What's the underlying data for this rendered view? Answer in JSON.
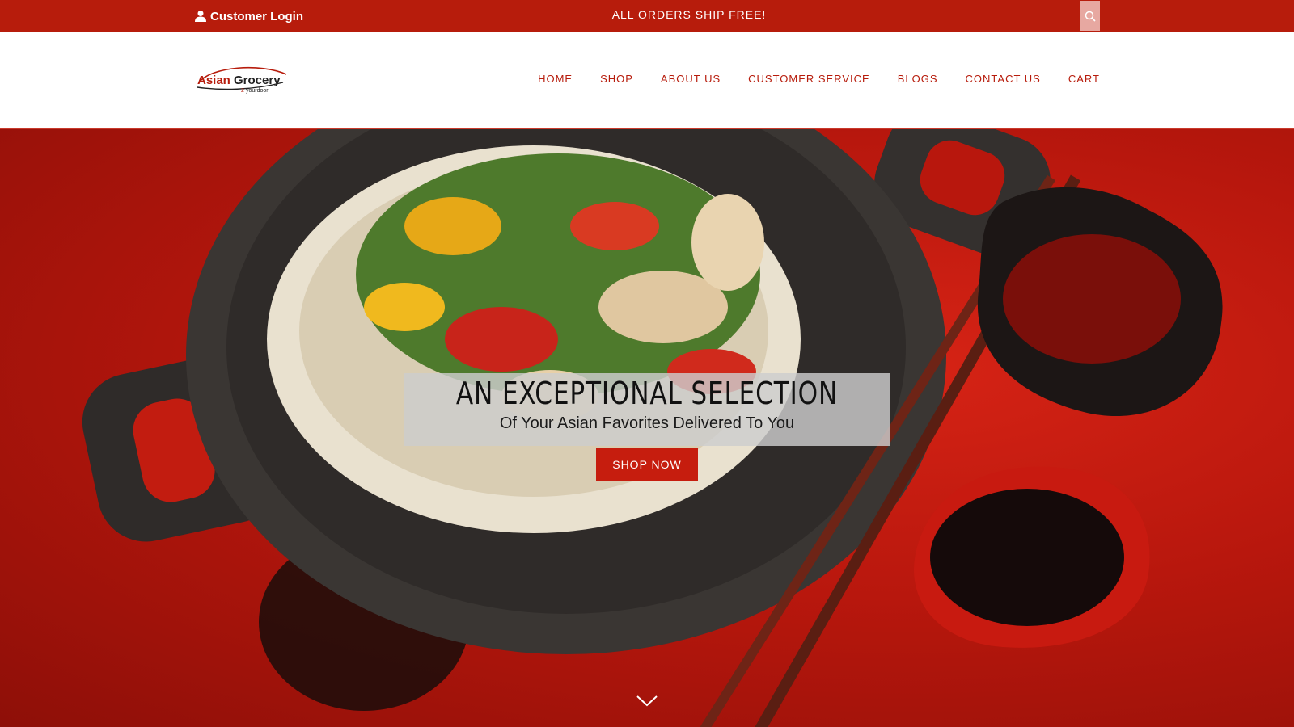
{
  "topbar": {
    "login_label": "Customer Login",
    "promo_text": "ALL ORDERS SHIP FREE!"
  },
  "header": {
    "logo": {
      "text_part1": "Asian",
      "text_part2": "Grocery",
      "tagline_number": "2",
      "tagline": "yourdoor"
    },
    "nav": [
      "HOME",
      "SHOP",
      "ABOUT US",
      "CUSTOMER SERVICE",
      "BLOGS",
      "CONTACT US",
      "CART"
    ]
  },
  "hero": {
    "title": "AN EXCEPTIONAL SELECTION",
    "subtitle": "Of Your Asian Favorites Delivered To You",
    "cta_label": "SHOP NOW"
  },
  "colors": {
    "brand_red": "#b71c0c",
    "button_red": "#c61d0e",
    "search_bg": "#e7a8a1"
  },
  "icons": {
    "login": "user-icon",
    "search": "search-icon",
    "scroll": "chevron-down-icon"
  }
}
